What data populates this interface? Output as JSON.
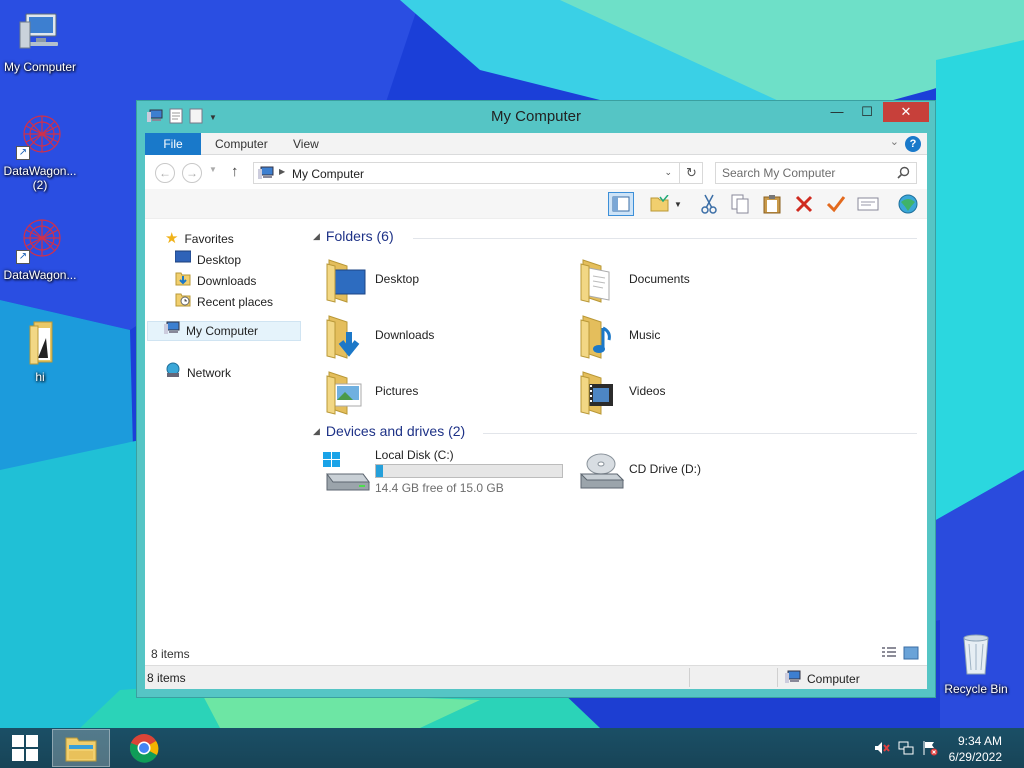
{
  "desktop": {
    "icons": [
      {
        "name": "My Computer"
      },
      {
        "name": "DataWagon...",
        "sub": "(2)"
      },
      {
        "name": "DataWagon..."
      },
      {
        "name": "hi"
      },
      {
        "name": "Recycle Bin"
      }
    ]
  },
  "window": {
    "title": "My Computer",
    "controls": {
      "minimize": "—",
      "maximize": "☐",
      "close": "✕"
    },
    "ribbon_tabs": [
      "File",
      "Computer",
      "View"
    ],
    "help": "?",
    "address": {
      "path": "My Computer",
      "search_placeholder": "Search My Computer"
    },
    "nav_pane": {
      "favorites": "Favorites",
      "favorite_items": [
        "Desktop",
        "Downloads",
        "Recent places"
      ],
      "computer": "My Computer",
      "network": "Network"
    },
    "groups": {
      "folders_header": "Folders (6)",
      "folders": [
        "Desktop",
        "Documents",
        "Downloads",
        "Music",
        "Pictures",
        "Videos"
      ],
      "drives_header": "Devices and drives (2)",
      "drives": [
        {
          "name": "Local Disk (C:)",
          "free_text": "14.4 GB free of 15.0 GB",
          "used_fraction": 0.04
        },
        {
          "name": "CD Drive (D:)"
        }
      ]
    },
    "status": {
      "items": "8 items",
      "bottom_items": "8 items",
      "zone": "Computer"
    }
  },
  "taskbar": {
    "time": "9:34 AM",
    "date": "6/29/2022"
  },
  "colors": {
    "accent": "#1979ca",
    "window_frame": "#55c5c5",
    "close": "#c7403a",
    "group_header": "#1e3287"
  }
}
